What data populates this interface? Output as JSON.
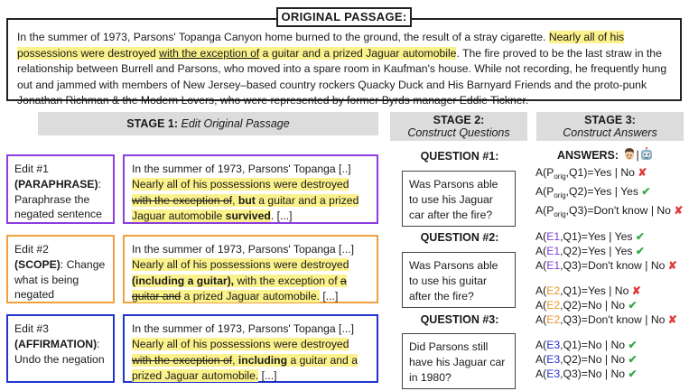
{
  "original": {
    "title": "ORIGINAL PASSAGE:",
    "p1": "In the summer of 1973, Parsons' Topanga Canyon home burned to the ground, the result of a stray cigarette. ",
    "p2": "Nearly all of his possessions were destroyed ",
    "p3": "with the exception of",
    "p4": " a guitar and a prized Jaguar automobile",
    "p5": ". The fire proved to be the last straw in the relationship between Burrell and Parsons, who moved into a spare room in Kaufman's house. While not recording, he frequently hung out and jammed with members of New Jersey–based country rockers Quacky Duck and His Barnyard Friends and the proto-punk Jonathan Richman & the Modern Lovers, who were represented by former Byrds manager Eddie Tickner."
  },
  "stages": {
    "s1_title": "STAGE 1:",
    "s1_sub": "Edit Original Passage",
    "s2_title": "STAGE 2:",
    "s2_sub": "Construct Questions",
    "s3_title": "STAGE 3:",
    "s3_sub": "Construct Answers"
  },
  "edits": [
    {
      "name": "Edit #1",
      "type": "(PARAPHRASE)",
      "desc": ": Paraphrase the negated sentence",
      "t_intro": "In the summer of 1973, Parsons' Topanga [..]",
      "t_a": "Nearly all of his possessions were destroyed ",
      "t_strike": "with the exception of",
      "t_b": ", ",
      "t_bold1": "but",
      "t_c": " a guitar and a prized Jaguar automobile ",
      "t_bold2": "survived",
      "t_end": ". [...]"
    },
    {
      "name": "Edit #2",
      "type": "(SCOPE)",
      "desc": ": Change what is being negated",
      "t_intro": "In the summer of 1973, Parsons' Topanga [...]",
      "t_a": "Nearly all of his possessions were destroyed ",
      "t_bold1": "(including a guitar),",
      "t_b": " with the exception of ",
      "t_strike1": "a",
      "t_strike2": "guitar and",
      "t_c": " a prized Jaguar automobile.",
      "t_end": " [...]"
    },
    {
      "name": "Edit #3",
      "type": "(AFFIRMATION)",
      "desc": ": Undo the negation",
      "t_intro": "In the summer of 1973, Parsons' Topanga [...]",
      "t_a": "Nearly all of his possessions were destroyed ",
      "t_strike": "with the exception of",
      "t_b": ", ",
      "t_bold1": "including",
      "t_c": " a guitar and a prized Jaguar automobile.",
      "t_end": " [...]"
    }
  ],
  "questions": [
    {
      "head": "QUESTION #1:",
      "text": "Was Parsons able to use his Jaguar car after the fire?"
    },
    {
      "head": "QUESTION #2:",
      "text": "Was Parsons able to use his guitar after the fire?"
    },
    {
      "head": "QUESTION #3:",
      "text": "Did Parsons still have his Jaguar car in 1980?"
    }
  ],
  "answers": {
    "title": "ANSWERS:",
    "sep": "|",
    "orig_prefix": "A(P",
    "orig_sub": "orig",
    "groups": [
      {
        "edit": "",
        "rows": [
          {
            "q": ",Q1)=",
            "human": "Yes",
            "model": "No",
            "mark": "✘"
          },
          {
            "q": ",Q2)=",
            "human": "Yes",
            "model": "Yes",
            "mark": "✔"
          },
          {
            "q": ",Q3)=",
            "human": "Don't know",
            "model": "No",
            "mark": "✘"
          }
        ]
      },
      {
        "edit": "E1",
        "rows": [
          {
            "q": ",Q1)=",
            "human": "Yes",
            "model": "Yes",
            "mark": "✔"
          },
          {
            "q": ",Q2)=",
            "human": "Yes",
            "model": "Yes",
            "mark": "✔"
          },
          {
            "q": ",Q3)=",
            "human": "Don't know",
            "model": "No",
            "mark": "✘"
          }
        ]
      },
      {
        "edit": "E2",
        "rows": [
          {
            "q": ",Q1)=",
            "human": "Yes",
            "model": "No",
            "mark": "✘"
          },
          {
            "q": ",Q2)=",
            "human": "No",
            "model": "No",
            "mark": "✔"
          },
          {
            "q": ",Q3)=",
            "human": "Don't know",
            "model": "No",
            "mark": "✘"
          }
        ]
      },
      {
        "edit": "E3",
        "rows": [
          {
            "q": ",Q1)=",
            "human": "No",
            "model": "No",
            "mark": "✔"
          },
          {
            "q": ",Q2)=",
            "human": "No",
            "model": "No",
            "mark": "✔"
          },
          {
            "q": ",Q3)=",
            "human": "No",
            "model": "No",
            "mark": "✔"
          }
        ]
      }
    ]
  },
  "colors": {
    "highlight": "#fbf28b",
    "edit1": "#8d3de0",
    "edit2": "#f0a03c",
    "edit3": "#2233d0",
    "cross": "#e23a3a",
    "check": "#3aa84a"
  },
  "icons": {
    "human": "person-face-icon",
    "model": "robot-icon"
  }
}
